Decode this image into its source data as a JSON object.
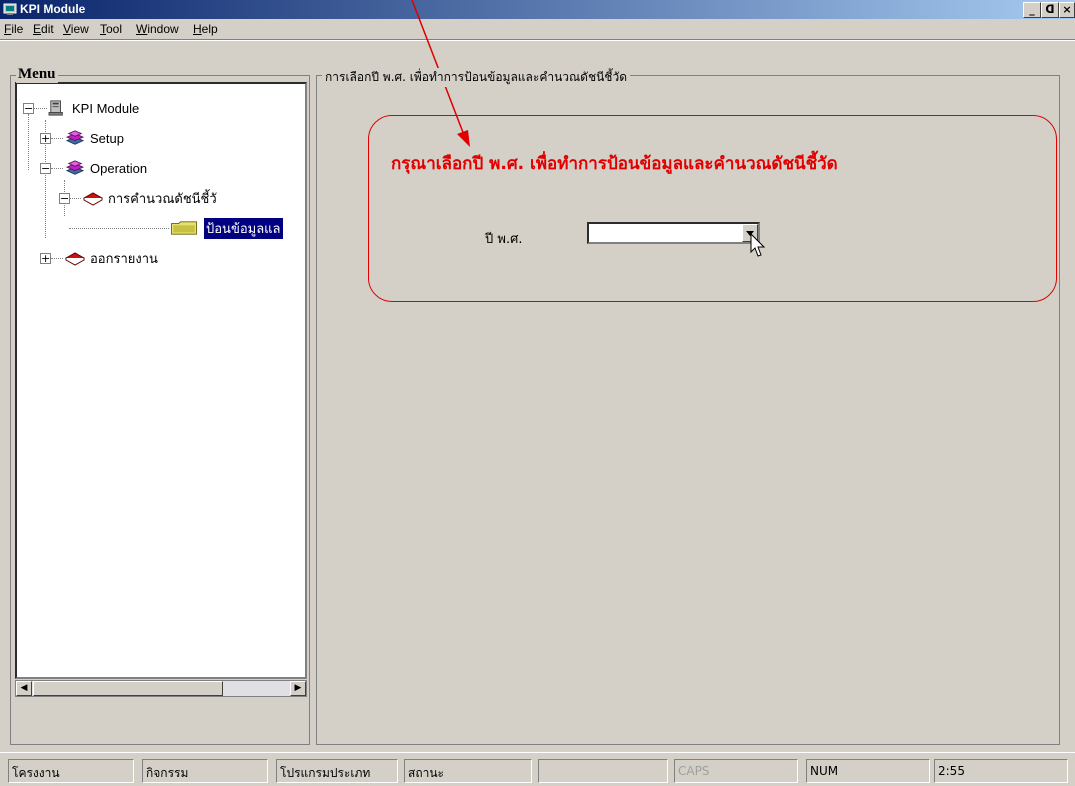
{
  "app": {
    "title": "KPI Module"
  },
  "window_controls": [
    {
      "name": "minimize-button",
      "glyph": "_"
    },
    {
      "name": "restore-button",
      "glyph": "ᗡ"
    },
    {
      "name": "close-button",
      "glyph": "×"
    }
  ],
  "menubar": [
    "File",
    "Edit",
    "View",
    "Tool",
    "Window",
    "Help"
  ],
  "menu_panel": {
    "title": "Menu"
  },
  "tree": {
    "root": "KPI Module",
    "items": [
      {
        "label": "Setup",
        "icon": "books-pink-icon",
        "expanded": false
      },
      {
        "label": "Operation",
        "icon": "books-pink-icon",
        "expanded": true
      },
      {
        "label": "การคำนวณดัชนีชี้วั",
        "icon": "red-book-icon",
        "expanded": true
      },
      {
        "label": "ป้อนข้อมูลแล",
        "icon": "folder-icon",
        "selected": true
      },
      {
        "label": "ออกรายงาน",
        "icon": "red-book-icon",
        "expanded": false
      }
    ]
  },
  "main": {
    "group_title": "การเลือกปี พ.ศ. เพื่อทำการป้อนข้อมูลและคำนวณดัชนีชี้วัด",
    "prompt": "กรุณาเลือกปี พ.ศ. เพื่อทำการป้อนข้อมูลและคำนวณดัชนีชี้วัด",
    "year_label": "ปี พ.ศ.",
    "year_value": ""
  },
  "statusbar": {
    "panels": [
      "โครงงาน",
      "กิจกรรม",
      "โปรแกรมประเภท",
      "สถานะ",
      "",
      "CAPS",
      "NUM",
      "2:55"
    ]
  },
  "colors": {
    "callout": "#e00000",
    "titlebar_start": "#0a246a",
    "titlebar_end": "#a6caf0",
    "selection": "#000080"
  }
}
